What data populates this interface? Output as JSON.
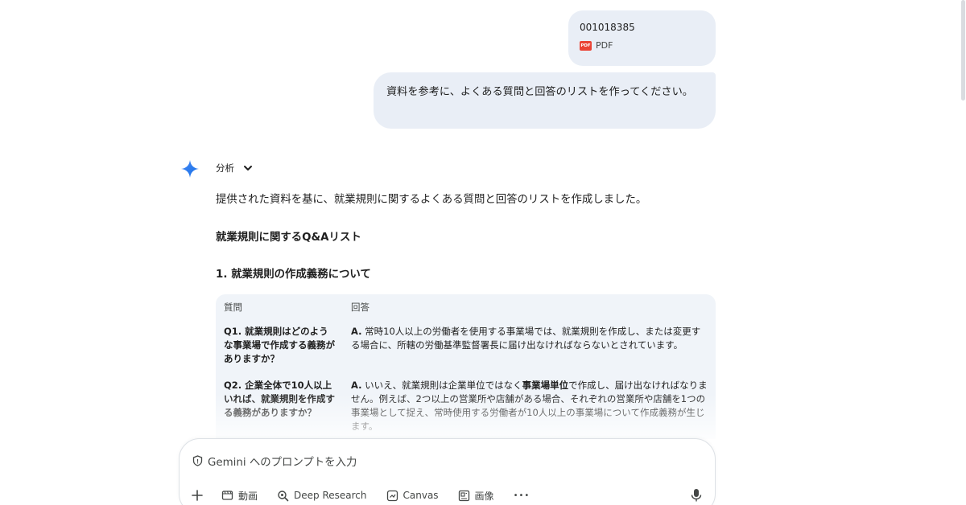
{
  "attachment": {
    "file_name": "001018385",
    "file_type": "PDF",
    "icon": "pdf-icon"
  },
  "user_prompt": "資料を参考に、よくある質問と回答のリストを作ってください。",
  "response": {
    "analysis_label": "分析",
    "intro": "提供された資料を基に、就業規則に関するよくある質問と回答のリストを作成しました。",
    "heading": "就業規則に関するQ&Aリスト",
    "section_title": "1. 就業規則の作成義務について",
    "table": {
      "headers": [
        "質問",
        "回答"
      ],
      "rows": [
        {
          "question": "Q1. 就業規則はどのような事業場で作成する義務がありますか？",
          "answer_prefix": "A.",
          "answer_text": " 常時10人以上の労働者を使用する事業場では、就業規則を作成し、または変更する場合に、所轄の労働基準監督署長に届け出なければならないとされています。"
        },
        {
          "question": "Q2. 企業全体で10人以上いれば、就業規則を作成する義務がありますか？",
          "answer_prefix": "A.",
          "answer_part1": " いいえ、就業規則は企業単位ではなく",
          "answer_bold": "事業場単位",
          "answer_part2": "で作成し、届け出なければなりません。例えば、2つ以上の営業所や店舗がある場合、それぞれの営業所や店舗を1つの事業場として捉え、常時使用する労働者が10人以上の事業場について作成義務が生じます。"
        }
      ]
    }
  },
  "input": {
    "placeholder": "Gemini へのプロンプトを入力",
    "tools": [
      {
        "label": "動画",
        "icon": "video-icon"
      },
      {
        "label": "Deep Research",
        "icon": "deep-research-icon"
      },
      {
        "label": "Canvas",
        "icon": "canvas-icon"
      },
      {
        "label": "画像",
        "icon": "image-icon"
      }
    ],
    "more_label": "•••"
  },
  "colors": {
    "bubble": "#e9eef6",
    "table_bg": "#f0f4f9",
    "gemini_blue": "#4285f4",
    "pdf_red": "#ea4335"
  }
}
